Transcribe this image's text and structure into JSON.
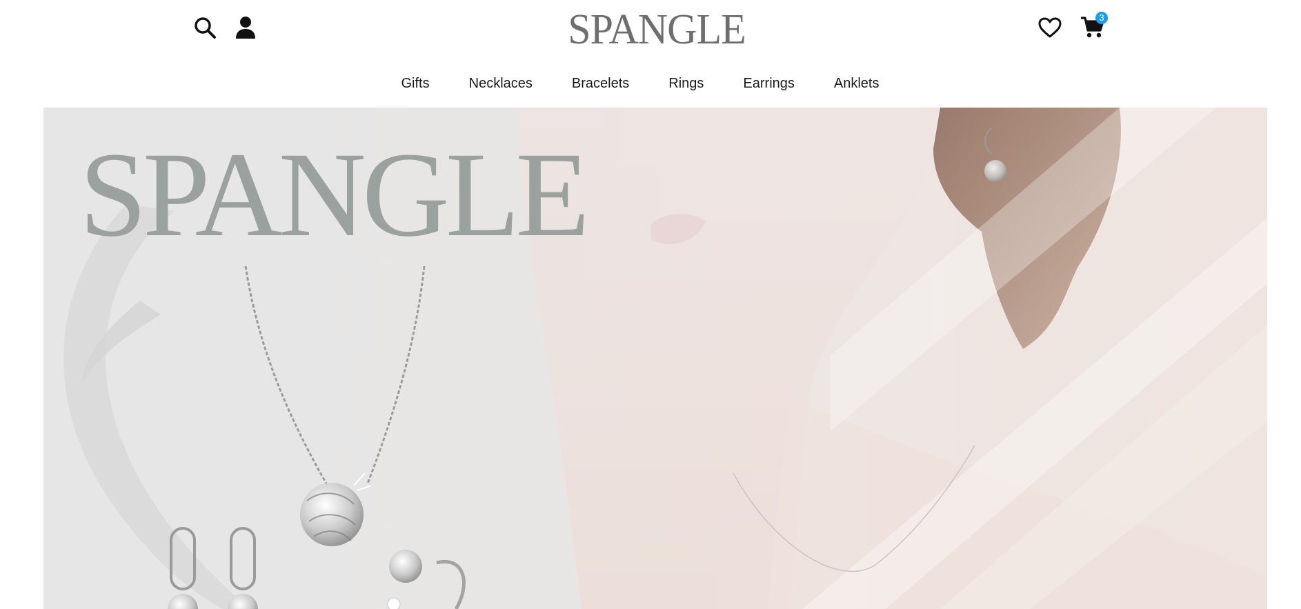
{
  "header": {
    "logo_text": "SPANGLE",
    "cart_count": "3",
    "icons": {
      "search": "search-icon",
      "account": "user-icon",
      "wishlist": "heart-icon",
      "cart": "cart-icon"
    }
  },
  "nav": {
    "items": [
      "Gifts",
      "Necklaces",
      "Bracelets",
      "Rings",
      "Earrings",
      "Anklets"
    ]
  },
  "hero": {
    "brand_text": "SPANGLE"
  },
  "colors": {
    "badge": "#1e9bea",
    "icon": "#111111",
    "hero_bg": "#e7e6e5"
  }
}
